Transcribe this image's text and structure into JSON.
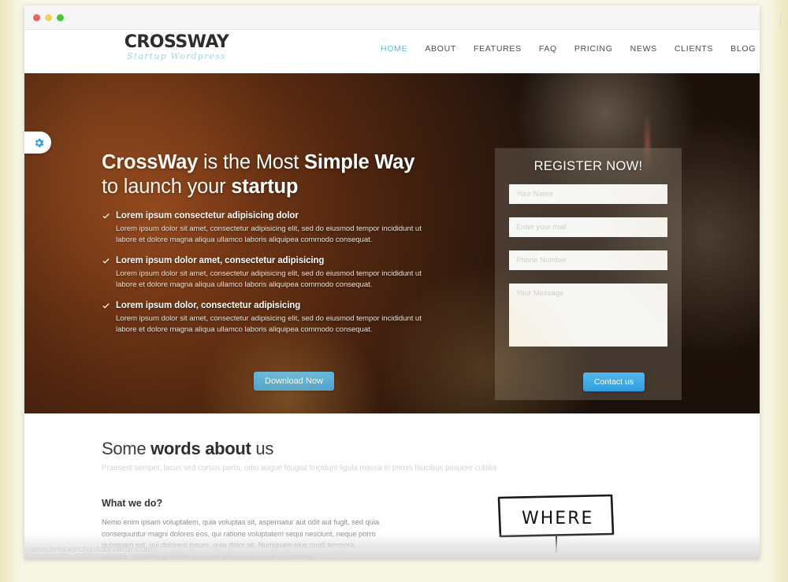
{
  "window": {
    "traffic_lights": [
      "close",
      "minimize",
      "maximize"
    ],
    "newtab_label": "+"
  },
  "header": {
    "logo_main": "CROSSWAY",
    "logo_sub": "Startup Wordpress",
    "nav": [
      {
        "label": "HOME",
        "active": true
      },
      {
        "label": "ABOUT",
        "active": false
      },
      {
        "label": "FEATURES",
        "active": false
      },
      {
        "label": "FAQ",
        "active": false
      },
      {
        "label": "PRICING",
        "active": false
      },
      {
        "label": "NEWS",
        "active": false
      },
      {
        "label": "CLIENTS",
        "active": false
      },
      {
        "label": "BLOG",
        "active": false
      }
    ]
  },
  "hero": {
    "settings_tab_icon": "gear-icon",
    "title_line1_strong": "CrossWay",
    "title_line1_rest": " is the Most ",
    "title_line1_strong2": "Simple Way",
    "title_line2_rest": "to launch your ",
    "title_line2_strong": "startup",
    "features": [
      {
        "heading": "Lorem ipsum consectetur adipisicing dolor",
        "body": "Lorem ipsum dolor sit amet, consectetur adipisicing elit, sed do eiusmod tempor incididunt ut labore et dolore magna aliqua ullamco laboris aliquipea commodo consequat."
      },
      {
        "heading": "Lorem ipsum dolor amet, consectetur adipisicing",
        "body": "Lorem ipsum dolor sit amet, consectetur adipisicing elit, sed do eiusmod tempor incididunt ut labore et dolore magna aliqua ullamco laboris aliquipea commodo consequat."
      },
      {
        "heading": "Lorem ipsum dolor, consectetur adipisicing",
        "body": "Lorem ipsum dolor sit amet, consectetur adipisicing elit, sed do eiusmod tempor incididunt ut labore et dolore magna aliqua ullamco laboris aliquipea commodo consequat."
      }
    ],
    "download_button": "Download Now"
  },
  "register": {
    "title": "REGISTER NOW!",
    "name_placeholder": "Your Name",
    "email_placeholder": "Enter your mail",
    "phone_placeholder": "Phone Number",
    "message_placeholder": "Your Message",
    "submit_button": "Contact us"
  },
  "about": {
    "title_pre": "Some ",
    "title_strong": "words about",
    "title_post": " us",
    "subtitle": "Praesent semper, lacus sed cursus porta, odio augue feugiat tincidunt ligula massa in primis faucibus posuere cubilia",
    "what_title": "What we do?",
    "what_body": "Nemo enim ipsam voluptatem, quia voluptas sit, aspernatur aut odit aut fugit, sed quia consequuntur magni dolores eos, qui ratione voluptatem sequi nesciunt, neque porro quisquam est, qui dolorem ipsum, quia dolor sit. Numquam eius modi tempora incidunt, ut labore et dolore magnam aliquam quaerat voluptatem.",
    "illustration_label": "WHERE"
  },
  "watermark": "www.heritagechristiancollege.com",
  "colors": {
    "accent_nav": "#4fc3d9",
    "button_blue": "#2f9fe0",
    "logo_sub": "#8fd3e0",
    "hero_dark": "#1c100a"
  }
}
